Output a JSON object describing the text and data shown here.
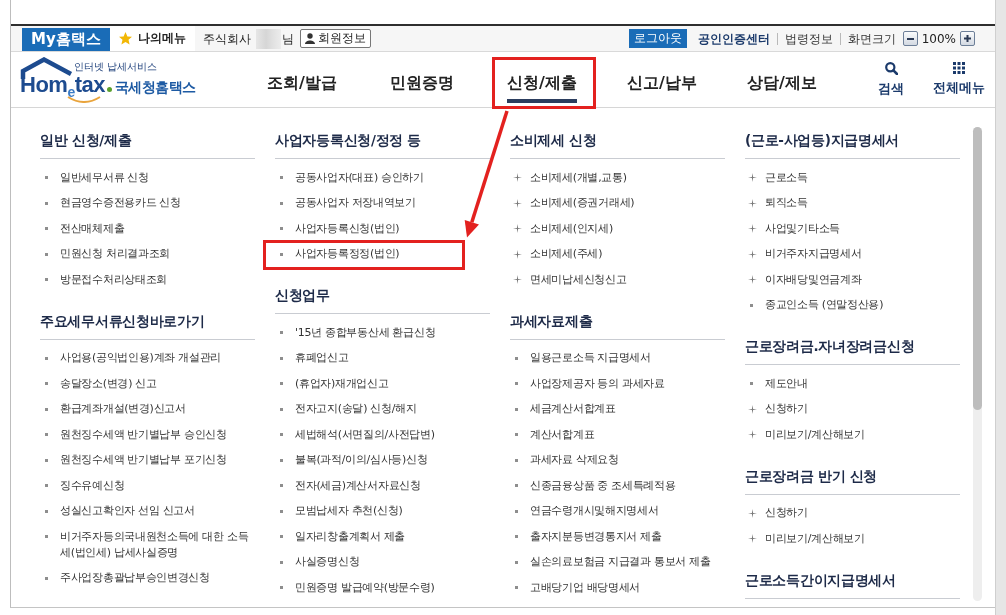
{
  "top_bar": {
    "brand_tab": "My홈택스",
    "my_menu": "나의메뉴",
    "user": {
      "prefix": "주식회사",
      "name_redacted": true,
      "suffix": "님"
    },
    "member_button": "회원정보",
    "logout_button": "로그아웃",
    "links": [
      {
        "label": "공인인증센터",
        "bold": true
      },
      {
        "label": "법령정보",
        "bold": false
      },
      {
        "label": "화면크기",
        "bold": false
      }
    ],
    "zoom_value": "100%"
  },
  "header": {
    "logo": {
      "tagline": "인터넷 납세서비스",
      "wordmark": "Hom$_{e}$tax",
      "name": "국세청홈택스"
    },
    "tabs": [
      {
        "label": "조회/발급",
        "selected": false,
        "highlighted": false
      },
      {
        "label": "민원증명",
        "selected": false,
        "highlighted": false
      },
      {
        "label": "신청/제출",
        "selected": true,
        "highlighted": true
      },
      {
        "label": "신고/납부",
        "selected": false,
        "highlighted": false
      },
      {
        "label": "상담/제보",
        "selected": false,
        "highlighted": false
      }
    ],
    "tools": [
      {
        "label": "검색",
        "kind": "search"
      },
      {
        "label": "전체메뉴",
        "kind": "all_menu"
      }
    ]
  },
  "menu": {
    "columns": [
      {
        "sections": [
          {
            "title": "일반 신청/제출",
            "items": [
              {
                "label": "일반세무서류 신청",
                "kind": "square",
                "highlighted": false
              },
              {
                "label": "현금영수증전용카드 신청",
                "kind": "square",
                "highlighted": false
              },
              {
                "label": "전산매체제출",
                "kind": "square",
                "highlighted": false
              },
              {
                "label": "민원신청 처리결과조회",
                "kind": "square",
                "highlighted": false
              },
              {
                "label": "방문접수처리상태조회",
                "kind": "square",
                "highlighted": false
              }
            ]
          },
          {
            "title": "주요세무서류신청바로가기",
            "items": [
              {
                "label": "사업용(공익법인용)계좌 개설관리",
                "kind": "square",
                "highlighted": false
              },
              {
                "label": "송달장소(변경) 신고",
                "kind": "square",
                "highlighted": false
              },
              {
                "label": "환급계좌개설(변경)신고서",
                "kind": "square",
                "highlighted": false
              },
              {
                "label": "원천징수세액 반기별납부 승인신청",
                "kind": "square",
                "highlighted": false
              },
              {
                "label": "원천징수세액 반기별납부 포기신청",
                "kind": "square",
                "highlighted": false
              },
              {
                "label": "징수유예신청",
                "kind": "square",
                "highlighted": false
              },
              {
                "label": "성실신고확인자 선임 신고서",
                "kind": "square",
                "highlighted": false
              },
              {
                "label": "비거주자등의국내원천소득에 대한 소득세(법인세) 납세사실증명",
                "kind": "square",
                "highlighted": false
              },
              {
                "label": "주사업장총괄납부승인변경신청",
                "kind": "square",
                "highlighted": false
              }
            ]
          }
        ]
      },
      {
        "sections": [
          {
            "title": "사업자등록신청/정정 등",
            "items": [
              {
                "label": "공동사업자(대표) 승인하기",
                "kind": "square",
                "highlighted": false
              },
              {
                "label": "공동사업자 저장내역보기",
                "kind": "square",
                "highlighted": false
              },
              {
                "label": "사업자등록신청(법인)",
                "kind": "square",
                "highlighted": false
              },
              {
                "label": "사업자등록정정(법인)",
                "kind": "square",
                "highlighted": true
              }
            ]
          },
          {
            "title": "신청업무",
            "items": [
              {
                "label": "'15년 종합부동산세 환급신청",
                "kind": "square",
                "highlighted": false
              },
              {
                "label": "휴폐업신고",
                "kind": "square",
                "highlighted": false
              },
              {
                "label": "(휴업자)재개업신고",
                "kind": "square",
                "highlighted": false
              },
              {
                "label": "전자고지(송달) 신청/해지",
                "kind": "square",
                "highlighted": false
              },
              {
                "label": "세법해석(서면질의/사전답변)",
                "kind": "square",
                "highlighted": false
              },
              {
                "label": "불복(과적/이의/심사등)신청",
                "kind": "square",
                "highlighted": false
              },
              {
                "label": "전자(세금)계산서자료신청",
                "kind": "square",
                "highlighted": false
              },
              {
                "label": "모범납세자 추천(신청)",
                "kind": "square",
                "highlighted": false
              },
              {
                "label": "일자리창출계획서 제출",
                "kind": "square",
                "highlighted": false
              },
              {
                "label": "사실증명신청",
                "kind": "square",
                "highlighted": false
              },
              {
                "label": "민원증명 발급예약(방문수령)",
                "kind": "square",
                "highlighted": false
              }
            ]
          }
        ]
      },
      {
        "sections": [
          {
            "title": "소비제세 신청",
            "items": [
              {
                "label": "소비제세(개별,교통)",
                "kind": "plus",
                "highlighted": false
              },
              {
                "label": "소비제세(증권거래세)",
                "kind": "plus",
                "highlighted": false
              },
              {
                "label": "소비제세(인지세)",
                "kind": "plus",
                "highlighted": false
              },
              {
                "label": "소비제세(주세)",
                "kind": "plus",
                "highlighted": false
              },
              {
                "label": "면세미납세신청신고",
                "kind": "plus",
                "highlighted": false
              }
            ]
          },
          {
            "title": "과세자료제출",
            "items": [
              {
                "label": "일용근로소득 지급명세서",
                "kind": "square",
                "highlighted": false
              },
              {
                "label": "사업장제공자 등의 과세자료",
                "kind": "square",
                "highlighted": false
              },
              {
                "label": "세금계산서합계표",
                "kind": "square",
                "highlighted": false
              },
              {
                "label": "계산서합계표",
                "kind": "square",
                "highlighted": false
              },
              {
                "label": "과세자료 삭제요청",
                "kind": "square",
                "highlighted": false
              },
              {
                "label": "신종금융상품 중 조세특례적용",
                "kind": "square",
                "highlighted": false
              },
              {
                "label": "연금수령개시및해지명세서",
                "kind": "square",
                "highlighted": false
              },
              {
                "label": "출자지분등변경통지서 제출",
                "kind": "square",
                "highlighted": false
              },
              {
                "label": "실손의료보험금 지급결과 통보서 제출",
                "kind": "square",
                "highlighted": false
              },
              {
                "label": "고배당기업 배당명세서",
                "kind": "square",
                "highlighted": false
              }
            ]
          }
        ]
      },
      {
        "sections": [
          {
            "title": "(근로-사업등)지급명세서",
            "items": [
              {
                "label": "근로소득",
                "kind": "plus",
                "highlighted": false
              },
              {
                "label": "퇴직소득",
                "kind": "plus",
                "highlighted": false
              },
              {
                "label": "사업및기타소득",
                "kind": "plus",
                "highlighted": false
              },
              {
                "label": "비거주자지급명세서",
                "kind": "plus",
                "highlighted": false
              },
              {
                "label": "이자배당및연금계좌",
                "kind": "plus",
                "highlighted": false
              },
              {
                "label": "종교인소득 (연말정산용)",
                "kind": "square",
                "highlighted": false
              }
            ]
          },
          {
            "title": "근로장려금.자녀장려금신청",
            "items": [
              {
                "label": "제도안내",
                "kind": "square",
                "highlighted": false
              },
              {
                "label": "신청하기",
                "kind": "plus",
                "highlighted": false
              },
              {
                "label": "미리보기/계산해보기",
                "kind": "plus",
                "highlighted": false
              }
            ]
          },
          {
            "title": "근로장려금 반기 신청",
            "items": [
              {
                "label": "신청하기",
                "kind": "plus",
                "highlighted": false
              },
              {
                "label": "미리보기/계산해보기",
                "kind": "plus",
                "highlighted": false
              }
            ]
          },
          {
            "title": "근로소득간이지급명세서"
          }
        ]
      }
    ]
  }
}
